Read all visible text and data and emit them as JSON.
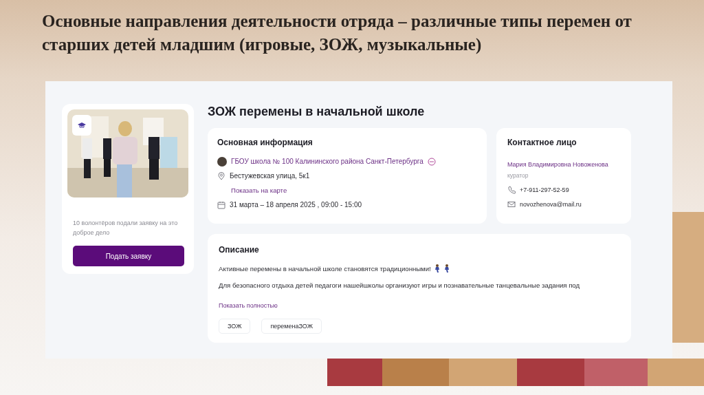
{
  "slide_title": "Основные направления деятельности отряда – различные типы перемен от старших детей младшим (игровые, ЗОЖ, музыкальные)",
  "event_page": {
    "side_card": {
      "volunteers_note": "10 волонтёров подали заявку на это доброе дело",
      "apply_button": "Подать заявку"
    },
    "title": "ЗОЖ перемены в начальной школе",
    "main_info": {
      "heading": "Основная информация",
      "organization": "ГБОУ школа № 100 Калининского района Санкт-Петербурга",
      "address": "Бестужевская улица, 5к1",
      "map_link": "Показать на карте",
      "dates": "31 марта – 18 апреля 2025 , 09:00 - 15:00"
    },
    "contact": {
      "heading": "Контактное лицо",
      "name": "Мария Владимировна Новоженова",
      "role": "куратор",
      "phone": "+7-911-297-52-59",
      "email": "novozhenova@mail.ru"
    },
    "description": {
      "heading": "Описание",
      "paragraphs": [
        "Активные перемены в начальной школе становятся традиционными!",
        "Для безопасного отдыха детей педагоги нашейшколы организуют игры и познавательные танцевальные задания под"
      ],
      "show_more": "Показать полностью",
      "tags": [
        "ЗОЖ",
        "переменаЗОЖ"
      ]
    }
  }
}
